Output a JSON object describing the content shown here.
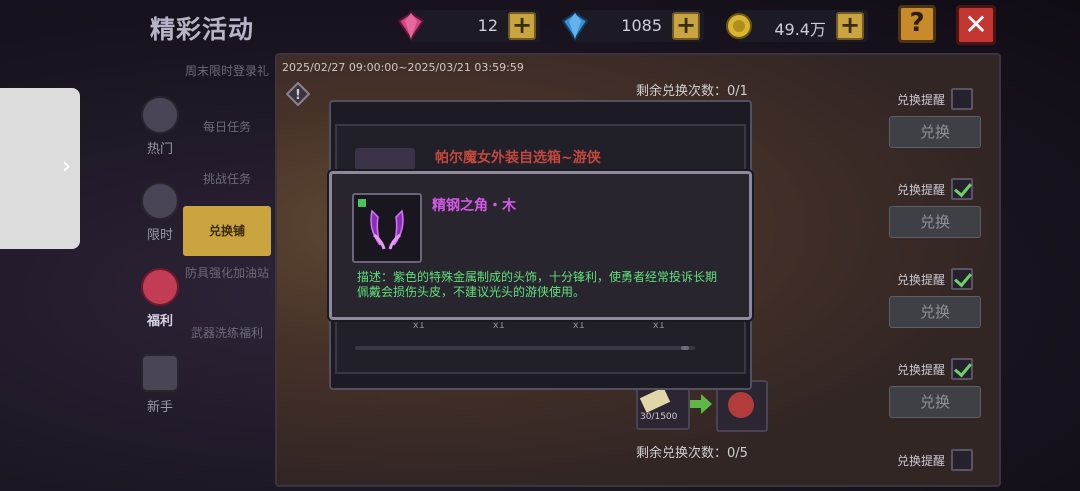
{
  "title": "精彩活动",
  "resources": [
    {
      "icon": "gem-pink-icon",
      "value": "12"
    },
    {
      "icon": "gem-blue-icon",
      "value": "1085"
    },
    {
      "icon": "gold-coin-icon",
      "value": "49.4万"
    }
  ],
  "plus_symbol": "+",
  "help_symbol": "?",
  "close_symbol": "✕",
  "drawer_arrow": "›",
  "categories": [
    {
      "label": "热门",
      "icon": "hot-icon"
    },
    {
      "label": "限时",
      "icon": "clock-icon"
    },
    {
      "label": "福利",
      "icon": "gift-bag-icon"
    },
    {
      "label": "新手",
      "icon": "newbie-icon"
    }
  ],
  "subtabs": [
    "周末限时登录礼",
    "每日任务",
    "挑战任务",
    "兑换铺",
    "防具强化加油站",
    "武器洗练福利"
  ],
  "event": {
    "dates": "2025/02/27 09:00:00~2025/03/21 03:59:59",
    "remaining_top": "剩余兑换次数：0/1",
    "remaining_bottom": "剩余兑换次数：0/5",
    "reminder_label": "兑换提醒",
    "exchange_label": "兑换",
    "cost_counter": "30/1500"
  },
  "box_dialog": {
    "title": "帕尔魔女外装自选箱~游侠",
    "slot_count": "x1"
  },
  "tooltip": {
    "item_name": "精钢之角・木",
    "description": "描述：紫色的特殊金属制成的头饰，十分锋利，使勇者经常投诉长期佩戴会损伤头皮，不建议光头的游侠使用。"
  },
  "reminders_checked": [
    false,
    true,
    true,
    true,
    false
  ],
  "colors": {
    "item_name": "#d25ae6",
    "description": "#5fe07a",
    "accent_gold": "#c9a441",
    "close_red": "#c33530"
  }
}
